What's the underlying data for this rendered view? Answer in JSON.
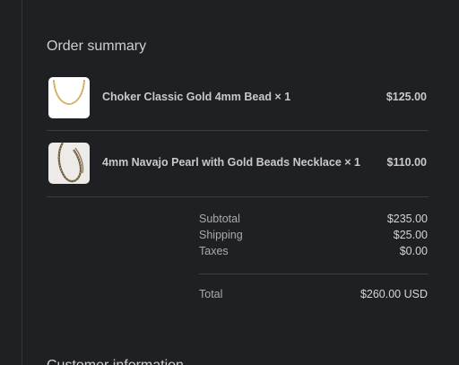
{
  "order_summary": {
    "title": "Order summary",
    "items": [
      {
        "image_icon": "gold-bead-choker-image",
        "name": "Choker Classic Gold 4mm Bead × 1",
        "price": "$125.00"
      },
      {
        "image_icon": "navajo-pearl-necklace-image",
        "name": "4mm Navajo Pearl with Gold Beads Necklace × 1",
        "price": "$110.00"
      }
    ],
    "subtotal_label": "Subtotal",
    "subtotal_value": "$235.00",
    "shipping_label": "Shipping",
    "shipping_value": "$25.00",
    "taxes_label": "Taxes",
    "taxes_value": "$0.00",
    "total_label": "Total",
    "total_value": "$260.00 USD"
  },
  "next_section": {
    "title": "Customer information"
  },
  "colors": {
    "background": "#1f2023",
    "divider": "#3a3c40",
    "text_primary": "#d6d6d8",
    "text_muted": "#a9aaad"
  }
}
